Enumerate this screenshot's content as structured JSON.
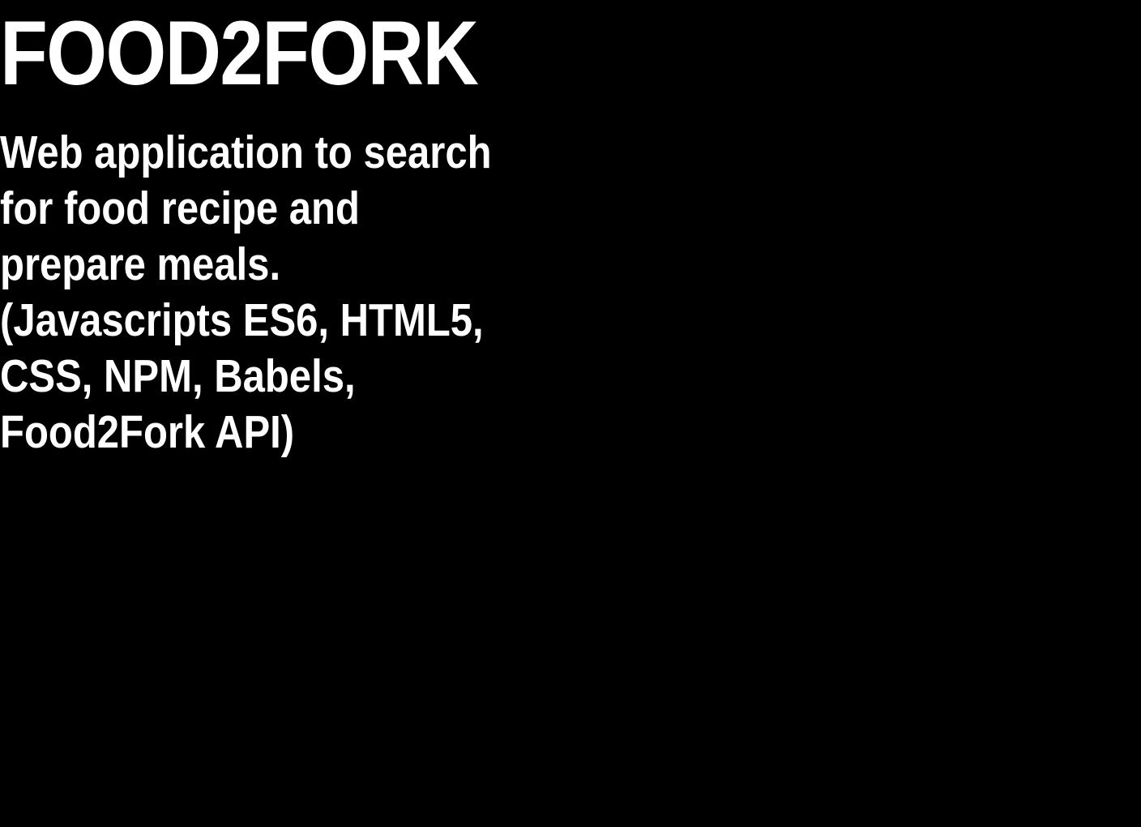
{
  "header": {
    "title": "FOOD2FORK"
  },
  "main": {
    "description": "Web application to search for food recipe and prepare meals. (Javascripts ES6, HTML5, CSS, NPM, Babels, Food2Fork API)"
  },
  "colors": {
    "background": "#000000",
    "text": "#ffffff"
  }
}
